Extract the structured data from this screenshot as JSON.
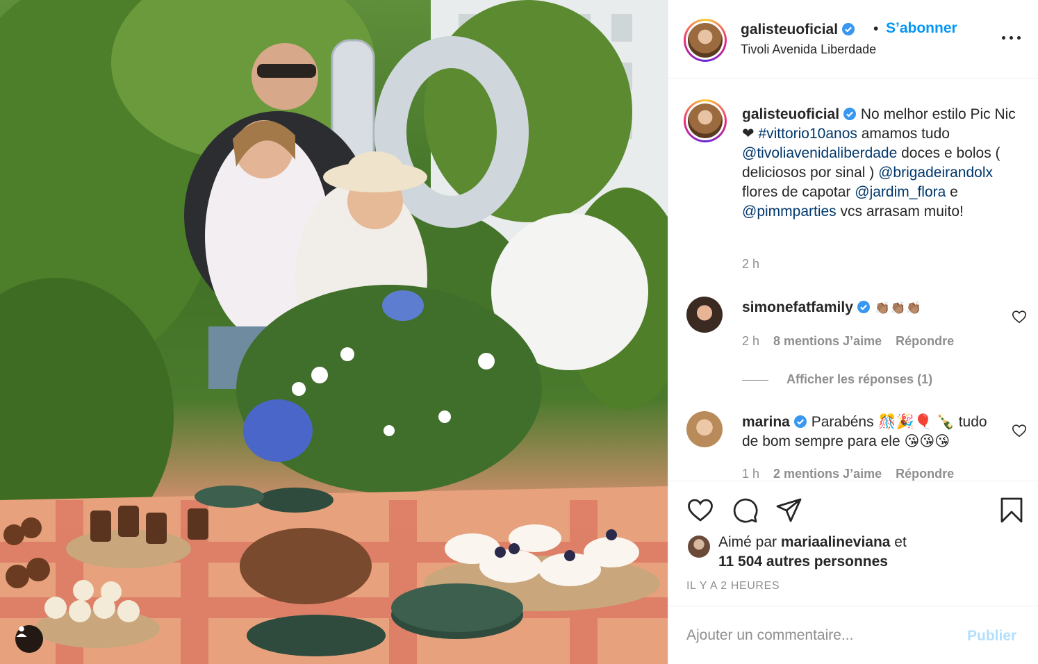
{
  "post": {
    "username": "galisteuoficial",
    "follow_label": "S’abonner",
    "separator": "•",
    "location": "Tivoli Avenida Liberdade"
  },
  "caption": {
    "username": "galisteuoficial",
    "parts": {
      "p1": "No melhor estilo Pic Nic ",
      "heart": "❤",
      "tag1": "#vittorio10anos",
      "p2": " amamos tudo ",
      "mention1": "@tivoliavenidaliberdade",
      "p3": " doces e bolos ( deliciosos por sinal ) ",
      "mention2": "@brigadeirandolx",
      "p4": " flores de capotar ",
      "mention3": "@jardim_flora",
      "p5": " e ",
      "mention4": "@pimmparties",
      "p6": " vcs arrasam muito!"
    },
    "time": "2 h"
  },
  "comments": [
    {
      "username": "simonefatfamily",
      "text": "👏🏽👏🏽👏🏽",
      "time": "2 h",
      "likes": "8 mentions J’aime",
      "reply": "Répondre",
      "view_replies": "Afficher les réponses (1)"
    },
    {
      "username": "marina",
      "text": "Parabéns 🎊🎉🎈 🍾 tudo de bom sempre para ele 😘😘😘",
      "time": "1 h",
      "likes": "2 mentions J’aime",
      "reply": "Répondre"
    }
  ],
  "likes": {
    "prefix": "Aimé par ",
    "user": "mariaalineviana",
    "middle": " et",
    "others": "11 504 autres personnes"
  },
  "posted_ago": "IL Y A 2 HEURES",
  "add_comment": {
    "placeholder": "Ajouter un commentaire...",
    "publish_label": "Publier"
  },
  "photo": {
    "balloon_text": "10"
  },
  "colors": {
    "accent": "#0095f6",
    "link": "#00376b",
    "muted": "#8e8e8e",
    "publish_disabled": "#b2dffc"
  },
  "icons": [
    "more-options-icon",
    "verified-badge-icon",
    "heart-icon",
    "comment-icon",
    "share-icon",
    "bookmark-icon",
    "user-tag-icon"
  ]
}
